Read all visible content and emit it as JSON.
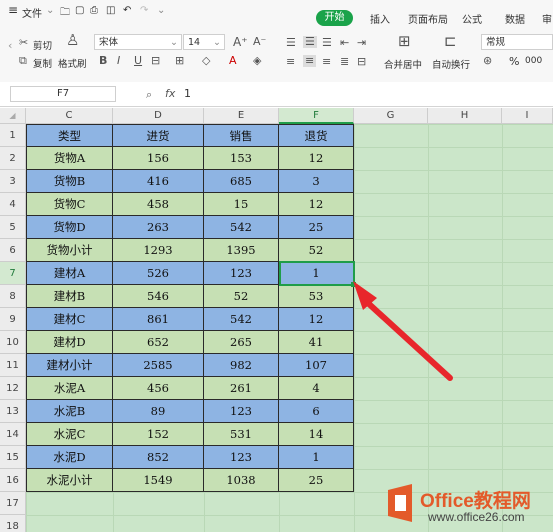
{
  "ribbon": {
    "menu_icon": "hamburger-icon",
    "file_label": "文件",
    "tabs": [
      "开始",
      "插入",
      "页面布局",
      "公式",
      "数据",
      "审"
    ],
    "cut": "剪切",
    "copy": "复制",
    "format_painter": "格式刷",
    "font_name": "宋体",
    "font_size": "14",
    "merge_center": "合并居中",
    "wrap_text": "自动换行",
    "number_format": "常规",
    "percent": "%",
    "thousands": "000"
  },
  "formula_bar": {
    "cell_ref": "F7",
    "fx": "fx",
    "value": "1"
  },
  "sheet": {
    "columns": [
      "C",
      "D",
      "E",
      "F",
      "G",
      "H",
      "I"
    ],
    "row_numbers": [
      "1",
      "2",
      "3",
      "4",
      "5",
      "6",
      "7",
      "8",
      "9",
      "10",
      "11",
      "12",
      "13",
      "14",
      "15",
      "16",
      "17",
      "18"
    ],
    "header": [
      "类型",
      "进货",
      "销售",
      "退货"
    ],
    "rows": [
      [
        "货物A",
        "156",
        "153",
        "12"
      ],
      [
        "货物B",
        "416",
        "685",
        "3"
      ],
      [
        "货物C",
        "458",
        "15",
        "12"
      ],
      [
        "货物D",
        "263",
        "542",
        "25"
      ],
      [
        "货物小计",
        "1293",
        "1395",
        "52"
      ],
      [
        "建材A",
        "526",
        "123",
        "1"
      ],
      [
        "建材B",
        "546",
        "52",
        "53"
      ],
      [
        "建材C",
        "861",
        "542",
        "12"
      ],
      [
        "建材D",
        "652",
        "265",
        "41"
      ],
      [
        "建材小计",
        "2585",
        "982",
        "107"
      ],
      [
        "水泥A",
        "456",
        "261",
        "4"
      ],
      [
        "水泥B",
        "89",
        "123",
        "6"
      ],
      [
        "水泥C",
        "152",
        "531",
        "14"
      ],
      [
        "水泥D",
        "852",
        "123",
        "1"
      ],
      [
        "水泥小计",
        "1549",
        "1038",
        "25"
      ]
    ],
    "colors": {
      "blue_row": "#8eb4e3",
      "green_row": "#c6e0b4",
      "selection": "#1f9d49",
      "arrow": "#e8262b"
    }
  },
  "watermark": {
    "brand": "Office教程网",
    "url": "www.office26.com"
  }
}
